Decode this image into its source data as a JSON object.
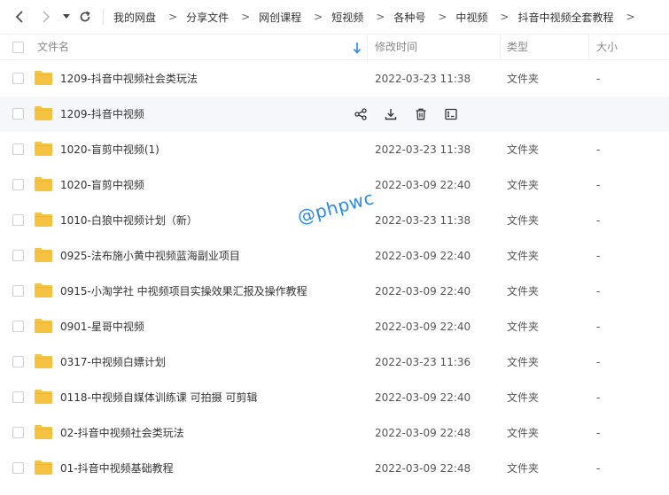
{
  "breadcrumb": [
    "我的网盘",
    "分享文件",
    "网创课程",
    "短视频",
    "各种号",
    "中视频",
    "抖音中视频全套教程"
  ],
  "breadcrumb_separator": ">",
  "header": {
    "name": "文件名",
    "time": "修改时间",
    "type": "类型",
    "size": "大小"
  },
  "rows": [
    {
      "name": "1209-抖音中视频社会类玩法",
      "time": "2022-03-23 11:38",
      "type": "文件夹",
      "size": "-"
    },
    {
      "name": "1209-抖音中视频",
      "time": "",
      "type": "",
      "size": "",
      "hovered": true
    },
    {
      "name": "1020-盲剪中视频(1)",
      "time": "2022-03-23 11:38",
      "type": "文件夹",
      "size": "-"
    },
    {
      "name": "1020-盲剪中视频",
      "time": "2022-03-09 22:40",
      "type": "文件夹",
      "size": "-"
    },
    {
      "name": "1010-白狼中视频计划（新）",
      "time": "2022-03-23 11:38",
      "type": "文件夹",
      "size": "-"
    },
    {
      "name": "0925-法布施小黄中视频蓝海副业项目",
      "time": "2022-03-09 22:40",
      "type": "文件夹",
      "size": "-"
    },
    {
      "name": "0915-小淘学社 中视频项目实操效果汇报及操作教程",
      "time": "2022-03-09 22:40",
      "type": "文件夹",
      "size": "-"
    },
    {
      "name": "0901-星哥中视频",
      "time": "2022-03-09 22:40",
      "type": "文件夹",
      "size": "-"
    },
    {
      "name": "0317-中视频白嫖计划",
      "time": "2022-03-23 11:36",
      "type": "文件夹",
      "size": "-"
    },
    {
      "name": "0118-中视频自媒体训练课  可拍摄 可剪辑",
      "time": "2022-03-09 22:40",
      "type": "文件夹",
      "size": "-"
    },
    {
      "name": "02-抖音中视频社会类玩法",
      "time": "2022-03-09 22:48",
      "type": "文件夹",
      "size": "-"
    },
    {
      "name": "01-抖音中视频基础教程",
      "time": "2022-03-09 22:48",
      "type": "文件夹",
      "size": "-"
    }
  ],
  "row_actions": [
    "share-icon",
    "download-icon",
    "delete-icon",
    "rename-icon"
  ],
  "watermark": "@phpwc",
  "colors": {
    "folder": "#f5c342",
    "accent": "#2c89e8",
    "hover_row": "#f5f7fa"
  }
}
